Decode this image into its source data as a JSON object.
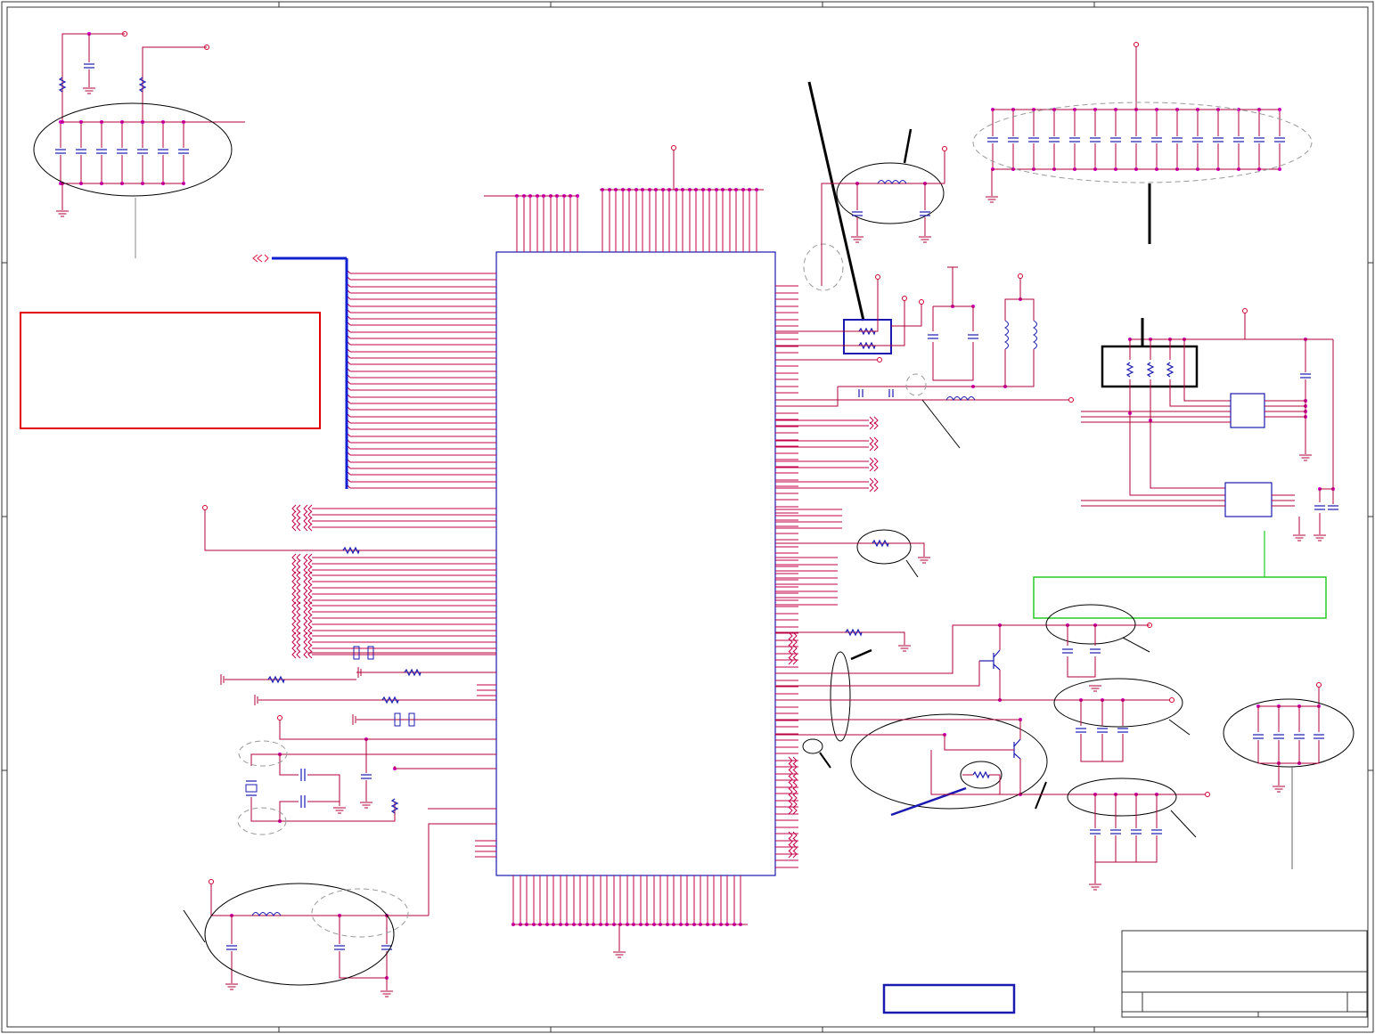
{
  "diagram": {
    "kind": "schematic",
    "colors": {
      "wire": "#b0003a",
      "pin": "#c4004a",
      "component": "#1a1ab0",
      "bus": "#1020d0",
      "junction": "#d000c8",
      "annotation_red_box": "#e00000",
      "annotation_green_box": "#22cc22",
      "annotation_blue_box": "#1a1ab0"
    },
    "title_block": {
      "present": true
    }
  }
}
